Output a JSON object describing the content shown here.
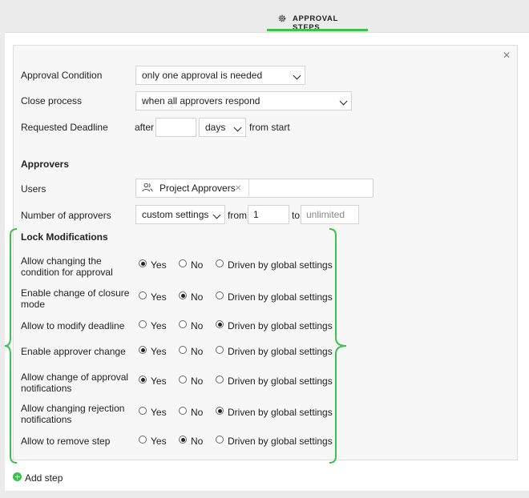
{
  "tab": {
    "label": "APPROVAL STEPS",
    "icon": "gear-icon"
  },
  "form": {
    "approval_condition": {
      "label": "Approval Condition",
      "value": "only one approval is needed"
    },
    "close_process": {
      "label": "Close process",
      "value": "when all approvers respond"
    },
    "deadline": {
      "label": "Requested Deadline",
      "prefix": "after",
      "value": "",
      "unit": "days",
      "suffix": "from start"
    },
    "approvers_heading": "Approvers",
    "users": {
      "label": "Users",
      "chip": "Project Approvers"
    },
    "num_approvers": {
      "label": "Number of approvers",
      "value": "custom settings",
      "from_label": "from",
      "from_value": "1",
      "to_label": "to",
      "to_placeholder": "unlimited"
    }
  },
  "lock": {
    "heading": "Lock Modifications",
    "options": [
      "Yes",
      "No",
      "Driven by global settings"
    ],
    "rows": [
      {
        "label1": "Allow changing the",
        "label2": "condition for approval",
        "selected": 0
      },
      {
        "label1": "Enable change of closure",
        "label2": "mode",
        "selected": 1
      },
      {
        "label1": "Allow to modify deadline",
        "label2": "",
        "selected": 2
      },
      {
        "label1": "Enable approver change",
        "label2": "",
        "selected": 0
      },
      {
        "label1": "Allow change of approval",
        "label2": "notifications",
        "selected": 0
      },
      {
        "label1": "Allow changing rejection",
        "label2": "notifications",
        "selected": 2
      },
      {
        "label1": "Allow to remove step",
        "label2": "",
        "selected": 1
      }
    ]
  },
  "add_step_label": "Add step",
  "colors": {
    "accent": "#3cc24a"
  }
}
